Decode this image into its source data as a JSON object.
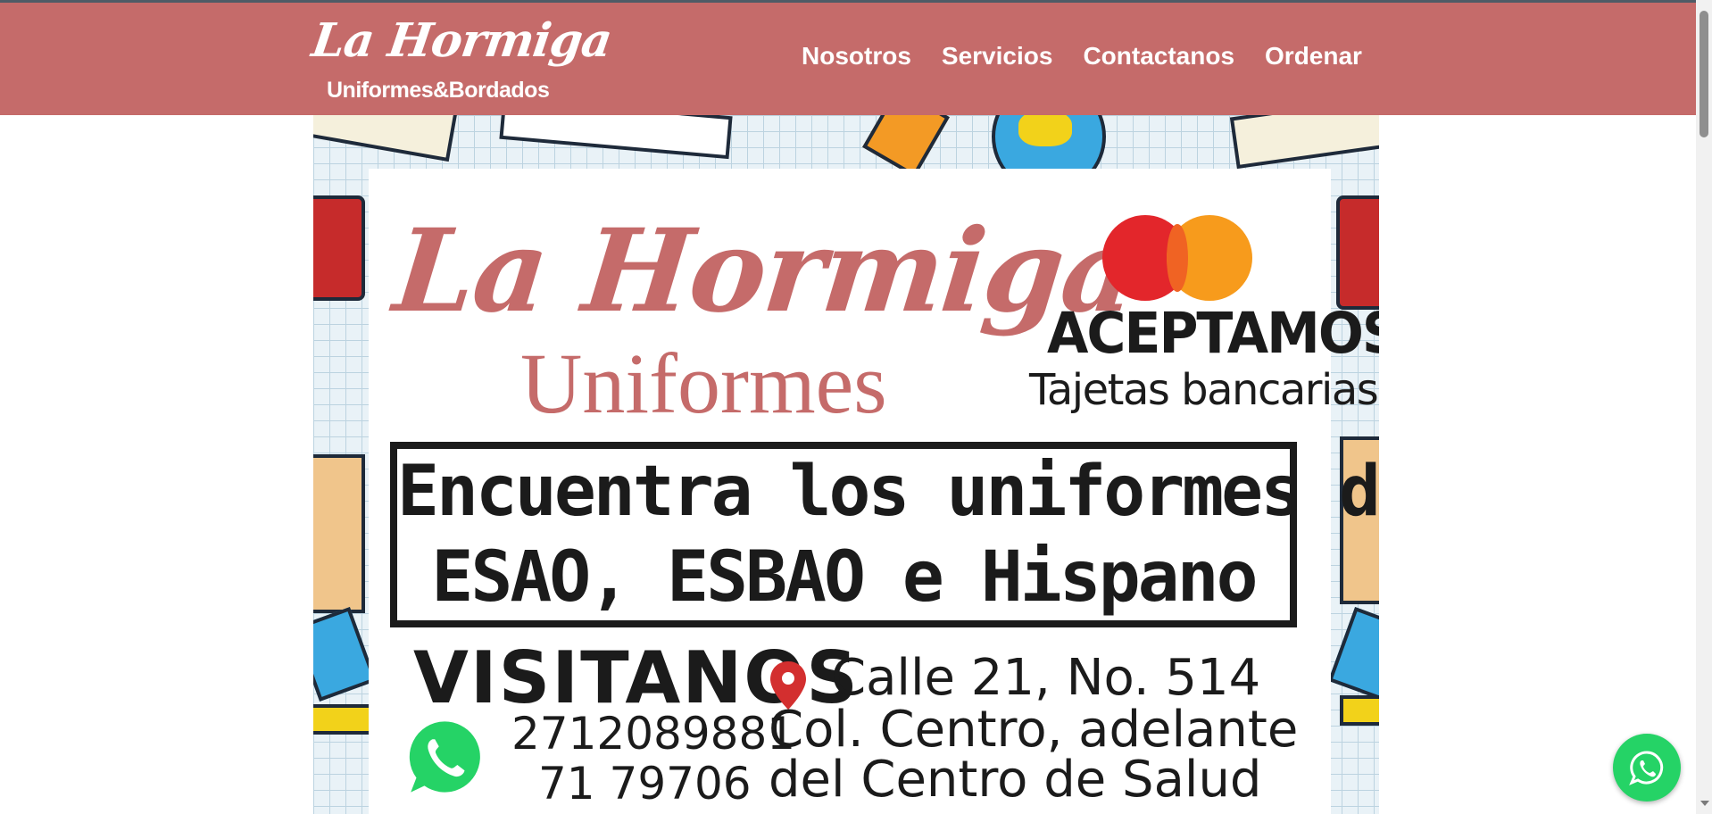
{
  "header": {
    "logo_title": "La Hormiga",
    "logo_subtitle": "Uniformes&Bordados",
    "nav": [
      "Nosotros",
      "Servicios",
      "Contactanos",
      "Ordenar"
    ]
  },
  "banner": {
    "brand_title": "La Hormiga",
    "brand_subtitle": "Uniformes",
    "accept_heading": "ACEPTAMOS",
    "accept_sub": "Tajetas bancarias",
    "message_line1": "Encuentra los uniformes de",
    "message_line2": "ESAO, ESBAO e Hispano",
    "visit_label": "VISITANOS",
    "phone1": "2712089881",
    "phone2": "71 79706",
    "address_line1": "Calle 21, No. 514",
    "address_line2": "Col. Centro, adelante",
    "address_line3": "del Centro de Salud"
  },
  "icons": {
    "whatsapp": "whatsapp-icon",
    "location": "location-pin-icon",
    "card_brand": "mastercard-logo"
  },
  "colors": {
    "brand": "#c56b6a",
    "whatsapp": "#25d366",
    "text_dark": "#1b1b1b"
  }
}
